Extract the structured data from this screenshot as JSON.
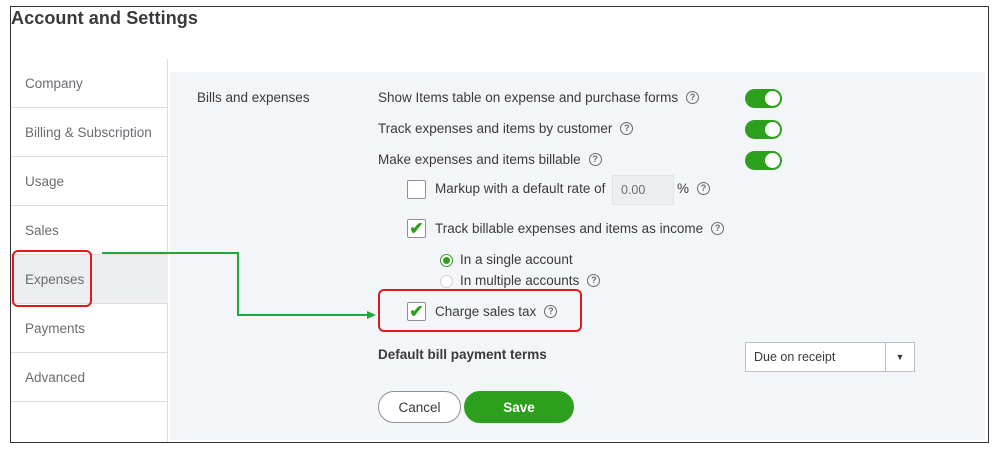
{
  "page": {
    "title": "Account and Settings"
  },
  "sidebar": {
    "items": [
      {
        "label": "Company"
      },
      {
        "label": "Billing & Subscription"
      },
      {
        "label": "Usage"
      },
      {
        "label": "Sales"
      },
      {
        "label": "Expenses",
        "active": true
      },
      {
        "label": "Payments"
      },
      {
        "label": "Advanced"
      }
    ]
  },
  "bills": {
    "section_label": "Bills and expenses",
    "show_items_table": {
      "label": "Show Items table on expense and purchase forms",
      "on": true
    },
    "track_by_customer": {
      "label": "Track expenses and items by customer",
      "on": true
    },
    "make_billable": {
      "label": "Make expenses and items billable",
      "on": true
    },
    "markup": {
      "label": "Markup with a default rate of",
      "checked": false,
      "value": "0.00",
      "unit": "%"
    },
    "track_income": {
      "label": "Track billable expenses and items as income",
      "checked": true
    },
    "radio_single": {
      "label": "In a single account",
      "selected": true
    },
    "radio_multiple": {
      "label": "In multiple accounts",
      "selected": false
    },
    "charge_sales_tax": {
      "label": "Charge sales tax",
      "checked": true
    },
    "payment_terms": {
      "label": "Default bill payment terms",
      "value": "Due on receipt"
    }
  },
  "buttons": {
    "cancel": "Cancel",
    "save": "Save"
  },
  "icons": {
    "help": "help-circle-icon",
    "check": "checkmark-icon",
    "dropdown": "caret-down-icon"
  },
  "colors": {
    "accent_green": "#2ca01c",
    "annotation_red": "#e0191e",
    "annotation_arrow": "#1fa83f"
  }
}
